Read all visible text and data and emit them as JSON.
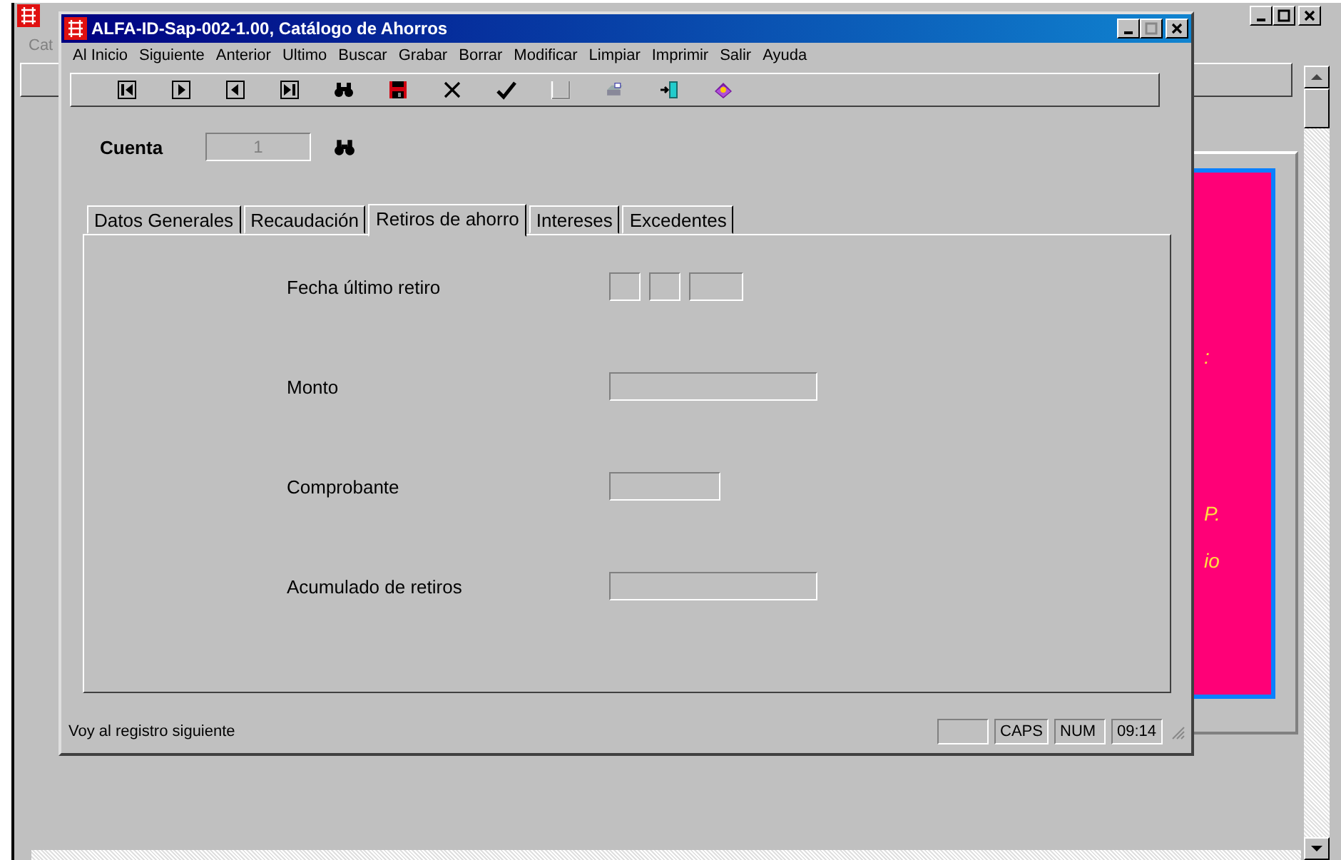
{
  "background_window": {
    "menu_fragment": "Cat",
    "panel_fragments": [
      ":",
      "P.",
      "io"
    ]
  },
  "window": {
    "title": "ALFA-ID-Sap-002-1.00, Catálogo de Ahorros"
  },
  "menu": [
    "Al Inicio",
    "Siguiente",
    "Anterior",
    "Ultimo",
    "Buscar",
    "Grabar",
    "Borrar",
    "Modificar",
    "Limpiar",
    "Imprimir",
    "Salir",
    "Ayuda"
  ],
  "cuenta": {
    "label": "Cuenta",
    "value": "1",
    "disabled": true
  },
  "tabs": [
    {
      "label": "Datos Generales",
      "selected": false
    },
    {
      "label": "Recaudación",
      "selected": false
    },
    {
      "label": "Retiros de ahorro",
      "selected": true
    },
    {
      "label": "Intereses",
      "selected": false
    },
    {
      "label": "Excedentes",
      "selected": false
    }
  ],
  "fields": [
    {
      "label": "Fecha último retiro",
      "kind": "date"
    },
    {
      "label": "Monto",
      "kind": "wide"
    },
    {
      "label": "Comprobante",
      "kind": "short"
    },
    {
      "label": "Acumulado de retiros",
      "kind": "wide"
    }
  ],
  "status_bar": {
    "message": "Voy al registro siguiente",
    "indicators": [
      "CAPS",
      "NUM",
      "09:14"
    ]
  }
}
